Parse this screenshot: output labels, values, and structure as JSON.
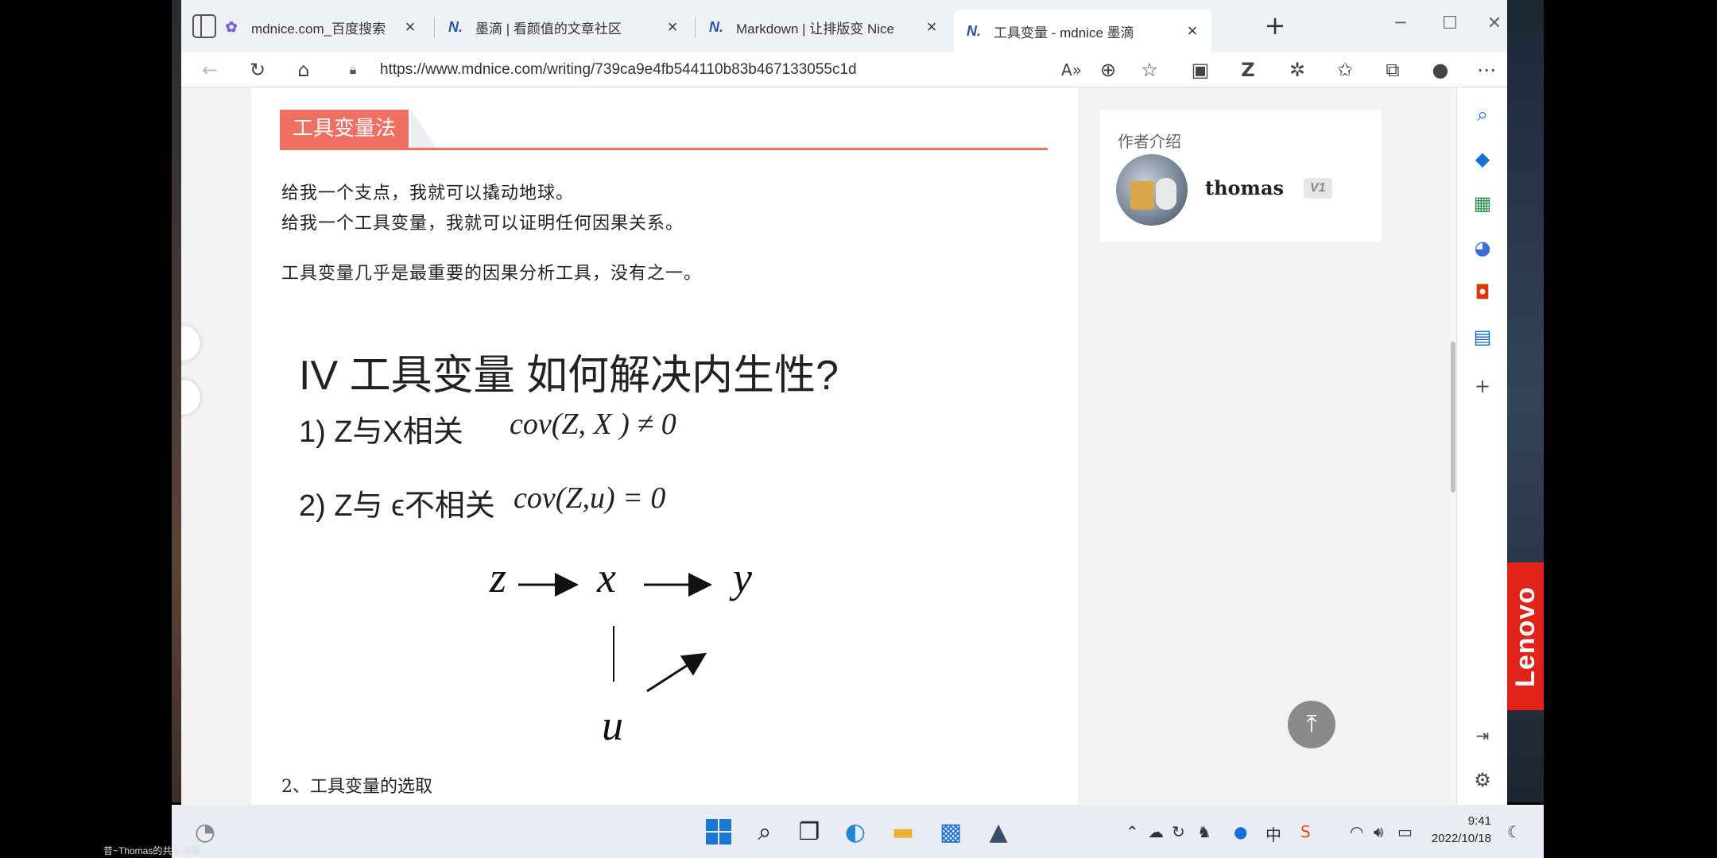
{
  "browser": {
    "tabs": [
      {
        "favicon": "baidu-paw-icon",
        "title": "mdnice.com_百度搜索",
        "active": false
      },
      {
        "favicon": "mdnice-n-icon",
        "title": "墨滴 | 看颜值的文章社区",
        "active": false
      },
      {
        "favicon": "mdnice-n-icon",
        "title": "Markdown | 让排版变 Nice",
        "active": false
      },
      {
        "favicon": "mdnice-n-icon",
        "title": "工具变量 - mdnice 墨滴",
        "active": true
      }
    ],
    "url": "https://www.mdnice.com/writing/739ca9e4fb544110b83b467133055c1d"
  },
  "article": {
    "section_badge": "工具变量法",
    "lines": [
      "给我一个支点，我就可以撬动地球。",
      "给我一个工具变量，我就可以证明任何因果关系。",
      "工具变量几乎是最重要的因果分析工具，没有之一。"
    ],
    "figure": {
      "title": "IV 工具变量 如何解决内生性?",
      "cond1": "1) Z与X相关",
      "eq1": "cov(Z, X ) ≠ 0",
      "cond2": "2) Z与 ϵ不相关",
      "eq2": "cov(Z,u) = 0",
      "node_z": "z",
      "node_x": "x",
      "node_y": "y",
      "node_u": "u"
    },
    "next_heading": "2、工具变量的选取"
  },
  "sidebar": {
    "label": "作者介绍",
    "author": "thomas",
    "level": "V1"
  },
  "taskbar": {
    "time": "9:41",
    "date": "2022/10/18",
    "ime": "中"
  },
  "desktop": {
    "brand": "Lenovo",
    "caption": "昔~Thomas的共享屏幕"
  }
}
